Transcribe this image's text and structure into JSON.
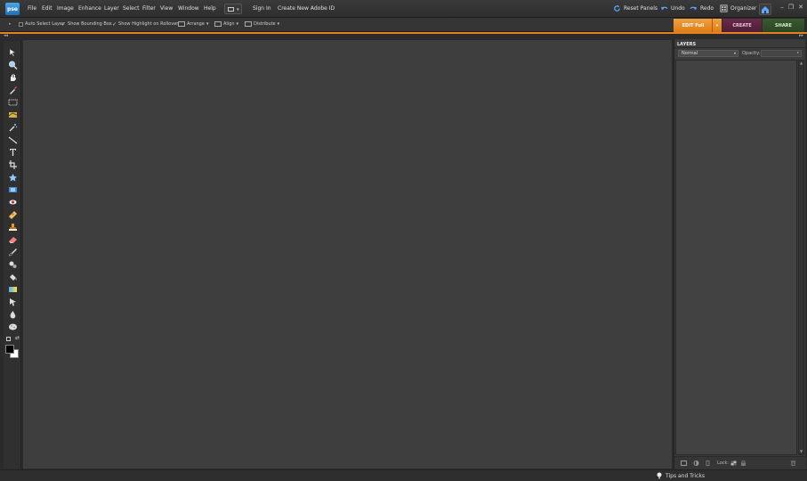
{
  "app": {
    "logo_text": "pse",
    "menu": [
      "File",
      "Edit",
      "Image",
      "Enhance",
      "Layer",
      "Select",
      "Filter",
      "View",
      "Window",
      "Help"
    ],
    "sign_in": "Sign In",
    "create_id": "Create New Adobe ID",
    "reset_panels": "Reset Panels",
    "undo": "Undo",
    "redo": "Redo",
    "organizer": "Organizer"
  },
  "options": {
    "auto_select_layer": "Auto Select Layer",
    "auto_select_checked": false,
    "show_bounding_box": "Show Bounding Box",
    "show_bounding_box_checked": true,
    "show_highlight": "Show Highlight on Rollover",
    "show_highlight_checked": true,
    "arrange": "Arrange",
    "align": "Align",
    "distribute": "Distribute"
  },
  "modes": {
    "edit": "EDIT Full",
    "create": "CREATE",
    "share": "SHARE"
  },
  "colors": {
    "accent": "#e8801e",
    "edit_tab": "#e8801e",
    "create_tab": "#5a2240",
    "share_tab": "#32502a",
    "canvas": "#3e3e3e"
  },
  "tools": [
    "move-tool",
    "zoom-tool",
    "hand-tool",
    "eyedropper-tool",
    "marquee-tool",
    "lasso-tool",
    "quick-selection-tool",
    "straighten-tool",
    "type-tool",
    "crop-tool",
    "cookie-cutter-tool",
    "recompose-tool",
    "red-eye-tool",
    "spot-healing-tool",
    "clone-stamp-tool",
    "eraser-tool",
    "brush-tool",
    "smart-brush-tool",
    "paint-bucket-tool",
    "gradient-tool",
    "shape-tool",
    "blur-tool",
    "sponge-tool",
    "color-swatch-tool"
  ],
  "layers_panel": {
    "title": "LAYERS",
    "blend_mode": "Normal",
    "opacity_label": "Opacity:",
    "opacity_value": "",
    "lock_label": "Lock:"
  },
  "status": {
    "tips": "Tips and Tricks"
  }
}
